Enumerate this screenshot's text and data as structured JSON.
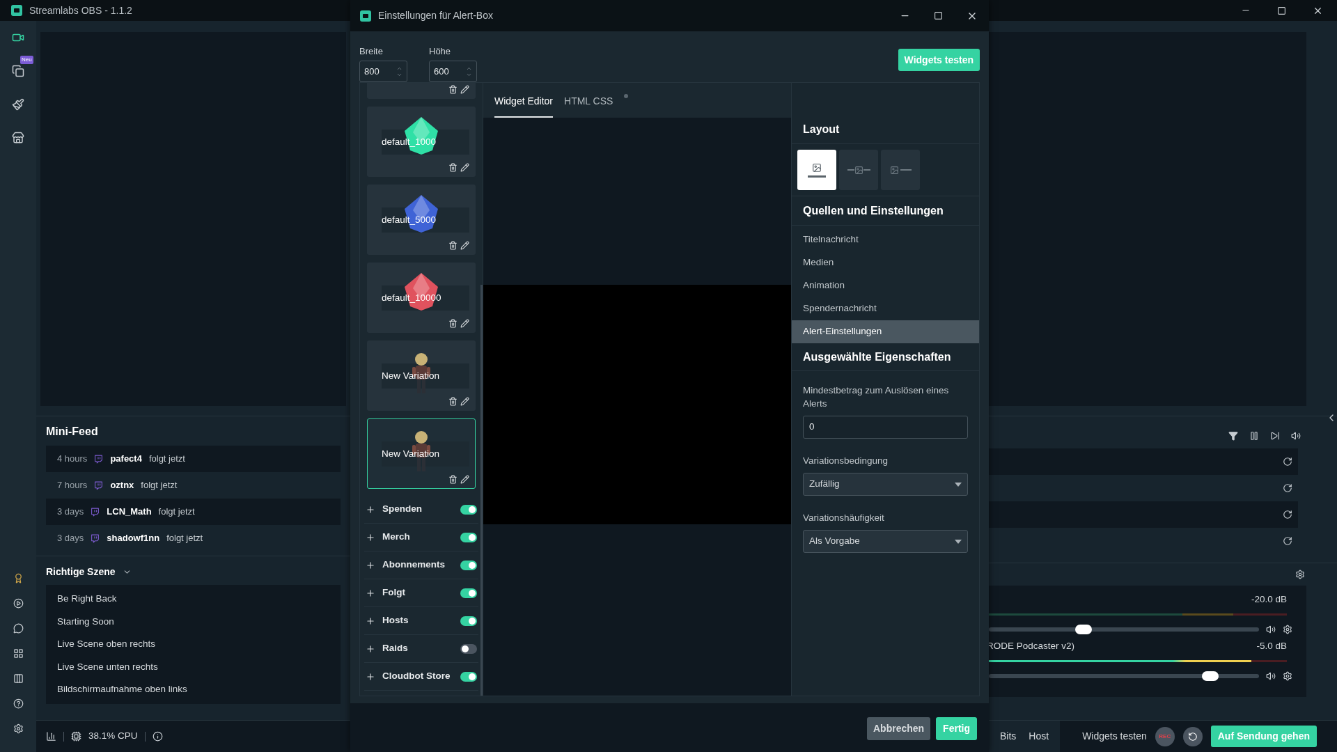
{
  "app": {
    "title": "Streamlabs OBS - 1.1.2"
  },
  "nav_top": [
    {
      "selected": true
    },
    {
      "selected": false,
      "badge": "Neu"
    },
    {
      "selected": false
    },
    {
      "selected": false
    }
  ],
  "nav_bottom": [
    {
      "selected": false
    },
    {
      "selected": false
    },
    {
      "selected": false
    },
    {
      "selected": false
    },
    {
      "selected": false
    },
    {
      "selected": false
    },
    {
      "selected": false
    }
  ],
  "mini_feed": {
    "title": "Mini-Feed",
    "events": [
      {
        "time": "4 hours",
        "user": "pafect4",
        "action": "folgt jetzt"
      },
      {
        "time": "7 hours",
        "user": "oztnx",
        "action": "folgt jetzt"
      },
      {
        "time": "3 days",
        "user": "LCN_Math",
        "action": "folgt jetzt"
      },
      {
        "time": "3 days",
        "user": "shadowf1nn",
        "action": "folgt jetzt"
      }
    ]
  },
  "scenes": {
    "title": "Richtige Szene",
    "items": [
      "Be Right Back",
      "Starting Soon",
      "Live Scene oben rechts",
      "Live Scene unten rechts",
      "Bildschirmaufnahme oben links"
    ]
  },
  "status": {
    "cpu": "38.1% CPU"
  },
  "mixer": {
    "sources": [
      {
        "reading": "-20.0 dB",
        "meter": {
          "level": 0
        },
        "level": 0.35
      },
      {
        "name": "RODE Podcaster v2)",
        "reading": "-5.0 dB",
        "meter": {
          "level": 0.88
        },
        "level": 0.82
      }
    ]
  },
  "bottom_bar": {
    "buttons": [
      "Bits",
      "Host"
    ],
    "test": "Widgets testen",
    "rec": "REC",
    "go_live": "Auf Sendung gehen"
  },
  "dialog": {
    "title": "Einstellungen für Alert-Box",
    "size_fields": [
      {
        "label": "Breite",
        "value": "800"
      },
      {
        "label": "Höhe",
        "value": "600"
      }
    ],
    "test_button": "Widgets testen",
    "variations": [
      {
        "kind": "clipped",
        "selected": false
      },
      {
        "kind": "gem",
        "name": "default_1000",
        "color": "#2fe0a6",
        "selected": false
      },
      {
        "kind": "gem",
        "name": "default_5000",
        "color": "#3f63d6",
        "selected": false
      },
      {
        "kind": "gem",
        "name": "default_10000",
        "color": "#e0525e",
        "selected": false
      },
      {
        "kind": "figure",
        "name": "New Variation",
        "selected": false
      },
      {
        "kind": "figure",
        "name": "New Variation",
        "selected": true
      }
    ],
    "categories": [
      {
        "name": "Spenden",
        "on": true
      },
      {
        "name": "Merch",
        "on": true
      },
      {
        "name": "Abonnements",
        "on": true
      },
      {
        "name": "Folgt",
        "on": true
      },
      {
        "name": "Hosts",
        "on": true
      },
      {
        "name": "Raids",
        "on": false
      },
      {
        "name": "Cloudbot Store",
        "on": true
      }
    ],
    "tabs": [
      {
        "label": "Widget Editor",
        "selected": true
      },
      {
        "label": "HTML CSS",
        "selected": false
      }
    ],
    "layout": {
      "title": "Layout",
      "options": [
        {
          "selected": true
        },
        {
          "selected": false
        },
        {
          "selected": false
        }
      ]
    },
    "sources": {
      "title": "Quellen und Einstellungen",
      "items": [
        {
          "label": "Titelnachricht",
          "selected": false
        },
        {
          "label": "Medien",
          "selected": false
        },
        {
          "label": "Animation",
          "selected": false
        },
        {
          "label": "Spendernachricht",
          "selected": false
        },
        {
          "label": "Alert-Einstellungen",
          "selected": true
        }
      ]
    },
    "properties": {
      "title": "Ausgewählte Eigenschaften",
      "fields": [
        {
          "kind": "input",
          "label": "Mindestbetrag zum Auslösen eines Alerts",
          "value": "0"
        },
        {
          "kind": "select",
          "label": "Variationsbedingung",
          "value": "Zufällig"
        },
        {
          "kind": "select",
          "label": "Variationshäufigkeit",
          "value": "Als Vorgabe"
        }
      ]
    },
    "footer": {
      "cancel": "Abbrechen",
      "done": "Fertig"
    }
  }
}
